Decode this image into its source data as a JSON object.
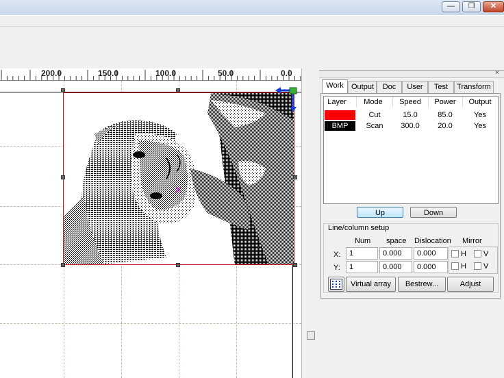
{
  "window": {
    "minimize_glyph": "—",
    "maximize_glyph": "❐",
    "close_glyph": "✕"
  },
  "ruler": {
    "labels": [
      "200.0",
      "150.0",
      "100.0",
      "50.0",
      "0.0"
    ]
  },
  "canvas": {
    "image": "dithered-portrait-bitmap",
    "center_marker": "×"
  },
  "panel": {
    "close_glyph": "×",
    "tabs": [
      {
        "label": "Work",
        "active": true
      },
      {
        "label": "Output"
      },
      {
        "label": "Doc"
      },
      {
        "label": "User"
      },
      {
        "label": "Test"
      },
      {
        "label": "Transform"
      }
    ],
    "layer_table": {
      "headers": [
        "Layer",
        "Mode",
        "Speed",
        "Power",
        "Output"
      ],
      "rows": [
        {
          "layer_label": "",
          "layer_color": "#ff0000",
          "mode": "Cut",
          "speed": "15.0",
          "power": "85.0",
          "output": "Yes"
        },
        {
          "layer_label": "BMP",
          "layer_color": "#000000",
          "mode": "Scan",
          "speed": "300.0",
          "power": "20.0",
          "output": "Yes"
        }
      ]
    },
    "up_label": "Up",
    "down_label": "Down",
    "line_column_setup": {
      "title": "Line/column setup",
      "col_num": "Num",
      "col_space": "space",
      "col_dislocation": "Dislocation",
      "col_mirror": "Mirror",
      "x_label": "X:",
      "y_label": "Y:",
      "x_num": "1",
      "x_space": "0.000",
      "x_dislocation": "0.000",
      "y_num": "1",
      "y_space": "0.000",
      "y_dislocation": "0.000",
      "mirror_h": "H",
      "mirror_v": "V"
    },
    "virtual_array_label": "Virtual array",
    "bestrew_label": "Bestrew...",
    "adjust_label": "Adjust"
  }
}
